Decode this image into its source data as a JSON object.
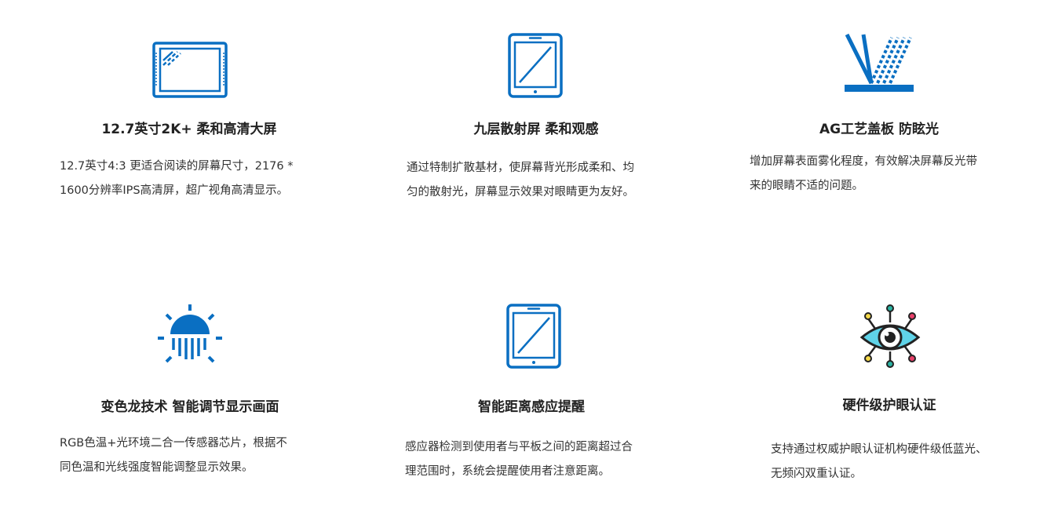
{
  "colors": {
    "accent": "#0a6fc2",
    "title": "#222222",
    "text": "#333333"
  },
  "features": [
    {
      "icon": "tablet-screen-icon",
      "title": "12.7英寸2K+ 柔和高清大屏",
      "lines": [
        "12.7英寸4:3  更适合阅读的屏幕尺寸，2176 *",
        "1600分辨率IPS高清屏，超广视角高清显示。"
      ]
    },
    {
      "icon": "tablet-diffuse-icon",
      "title": "九层散射屏  柔和观感",
      "lines": [
        "通过特制扩散基材，使屏幕背光形成柔和、均",
        "匀的散射光，屏幕显示效果对眼睛更为友好。"
      ]
    },
    {
      "icon": "anti-glare-icon",
      "title": "AG工艺盖板  防眩光",
      "lines": [
        "增加屏幕表面雾化程度，有效解决屏幕反光带",
        "来的眼睛不适的问题。"
      ]
    },
    {
      "icon": "color-temperature-sun-icon",
      "title": "变色龙技术  智能调节显示画面",
      "lines": [
        "RGB色温+光环境二合一传感器芯片，根据不",
        "同色温和光线强度智能调整显示效果。"
      ]
    },
    {
      "icon": "tablet-distance-icon",
      "title": "智能距离感应提醒",
      "lines": [
        "感应器检测到使用者与平板之间的距离超过合",
        "理范围时，系统会提醒使用者注意距离。"
      ]
    },
    {
      "icon": "eye-protection-icon",
      "title": "硬件级护眼认证",
      "lines": [
        "支持通过权威护眼认证机构硬件级低蓝光、",
        "无频闪双重认证。"
      ]
    }
  ]
}
